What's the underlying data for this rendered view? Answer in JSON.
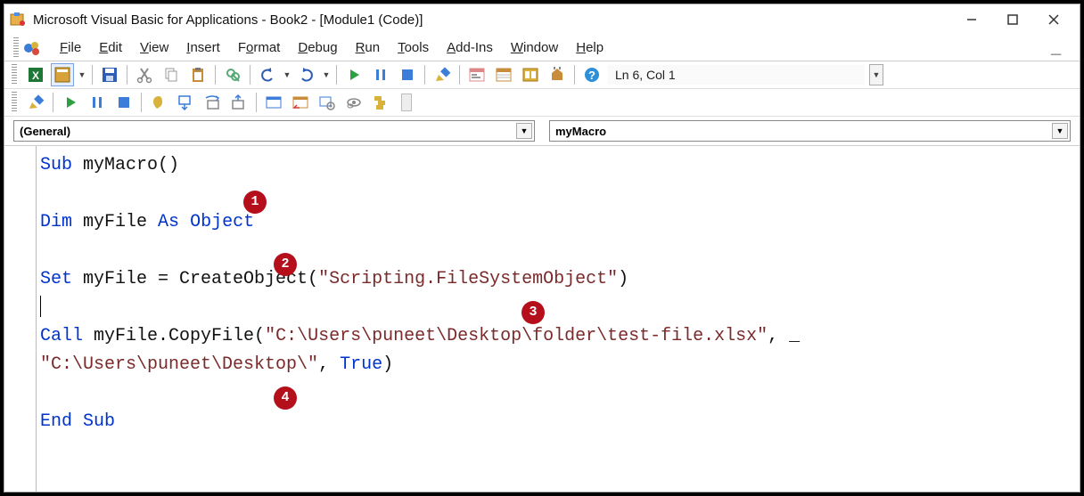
{
  "titlebar": {
    "title": "Microsoft Visual Basic for Applications - Book2 - [Module1 (Code)]"
  },
  "menubar": {
    "items": [
      {
        "accel": "F",
        "rest": "ile"
      },
      {
        "accel": "E",
        "rest": "dit"
      },
      {
        "accel": "V",
        "rest": "iew"
      },
      {
        "accel": "I",
        "rest": "nsert"
      },
      {
        "accel": "",
        "rest": "F",
        "accel2": "o",
        "rest2": "rmat"
      },
      {
        "accel": "D",
        "rest": "ebug"
      },
      {
        "accel": "R",
        "rest": "un"
      },
      {
        "accel": "T",
        "rest": "ools"
      },
      {
        "accel": "A",
        "rest": "dd-Ins"
      },
      {
        "accel": "W",
        "rest": "indow"
      },
      {
        "accel": "H",
        "rest": "elp"
      }
    ]
  },
  "toolbar": {
    "cursor_position": "Ln 6, Col 1"
  },
  "dropdowns": {
    "object": "(General)",
    "procedure": "myMacro"
  },
  "code": {
    "l1a": "Sub",
    "l1b": " myMacro()",
    "l3a": "Dim",
    "l3b": " myFile ",
    "l3c": "As",
    "l3d": " ",
    "l3e": "Object",
    "l5a": "Set",
    "l5b": " myFile = CreateObject(",
    "l5c": "\"Scripting.FileSystemObject\"",
    "l5d": ")",
    "l7a": "Call",
    "l7b": " myFile.CopyFile(",
    "l7c": "\"C:\\Users\\puneet\\Desktop\\folder\\test-file.xlsx\"",
    "l7d": ", _",
    "l8a": "\"C:\\Users\\puneet\\Desktop\\\"",
    "l8b": ", ",
    "l8c": "True",
    "l8d": ")",
    "l10a": "End Sub"
  },
  "badges": {
    "b1": "1",
    "b2": "2",
    "b3": "3",
    "b4": "4"
  }
}
